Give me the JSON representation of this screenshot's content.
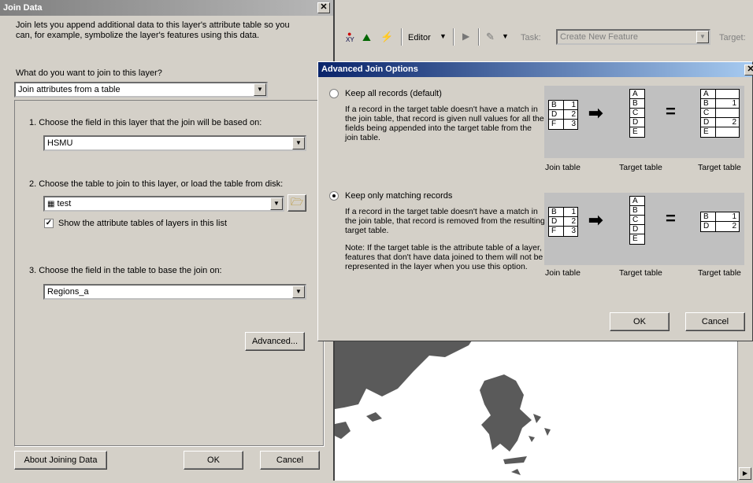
{
  "toolbar": {
    "editor_label": "Editor",
    "task_label": "Task:",
    "task_value": "Create New Feature",
    "target_label": "Target:",
    "xy_label": "XY"
  },
  "join_dialog": {
    "title": "Join Data",
    "intro": "Join lets you append additional data to this layer's attribute table so you can, for example, symbolize the layer's features using this data.",
    "question": "What do you want to join to this layer?",
    "join_type": "Join attributes from a table",
    "step1_label": "1.  Choose the field in this layer that the join will be based on:",
    "step1_value": "HSMU",
    "step2_label": "2.  Choose the table to join to this layer, or load the table from disk:",
    "step2_value": "test",
    "show_attr_label": "Show the attribute tables of layers in this list",
    "step3_label": "3.  Choose the field in the table to base the join on:",
    "step3_value": "Regions_a",
    "advanced_button": "Advanced...",
    "about_button": "About Joining Data",
    "ok_button": "OK",
    "cancel_button": "Cancel"
  },
  "adv_dialog": {
    "title": "Advanced Join Options",
    "opt1_label": "Keep all records (default)",
    "opt1_desc": "If a record in the target table doesn't have a match in the join table, that record is given null values for all the fields being appended into the target table from the join table.",
    "opt2_label": "Keep only matching records",
    "opt2_desc": "If a record in the target table doesn't have a match in the join table, that record is removed from the resulting target table.",
    "opt2_note": "Note: If the target table is the attribute table of a layer, features that don't have data joined to them will not be represented in the layer when you use this option.",
    "selected_option": 2,
    "caption_join": "Join table",
    "caption_target": "Target table",
    "caption_result": "Target table",
    "join_rows": [
      [
        "B",
        "1"
      ],
      [
        "D",
        "2"
      ],
      [
        "F",
        "3"
      ]
    ],
    "target_rows": [
      "A",
      "B",
      "C",
      "D",
      "E"
    ],
    "result_all_rows": [
      [
        "A",
        ""
      ],
      [
        "B",
        "1"
      ],
      [
        "C",
        ""
      ],
      [
        "D",
        "2"
      ],
      [
        "E",
        ""
      ]
    ],
    "result_match_rows": [
      [
        "B",
        "1"
      ],
      [
        "D",
        "2"
      ]
    ],
    "ok_button": "OK",
    "cancel_button": "Cancel"
  },
  "colors": {
    "dialog_bg": "#d4d0c8",
    "active_title": "#0a246a",
    "inactive_title": "#808080",
    "map_land": "#5a5a5a"
  }
}
